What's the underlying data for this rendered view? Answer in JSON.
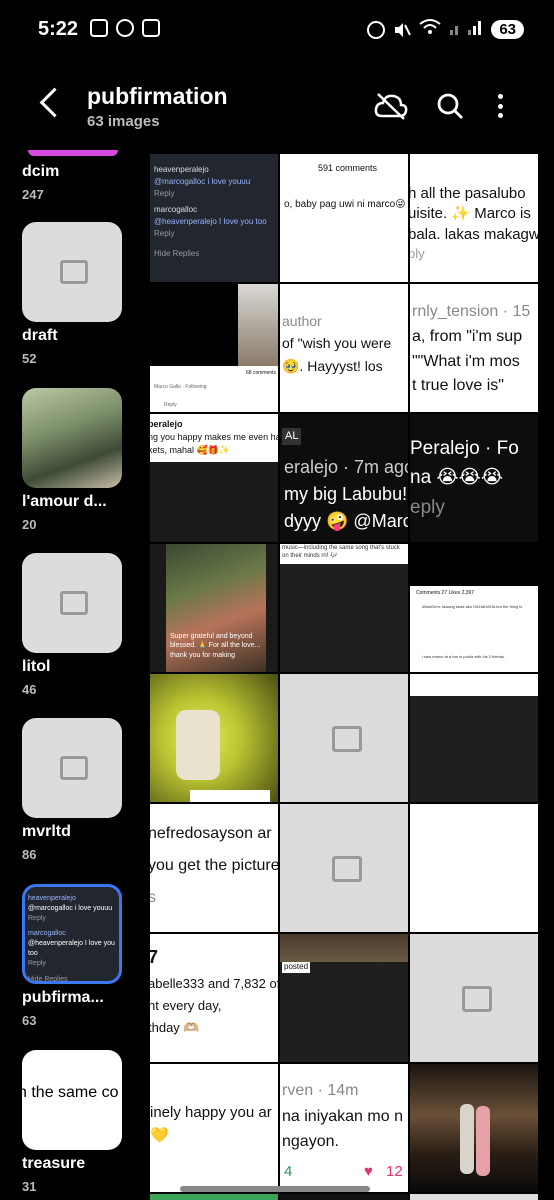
{
  "status": {
    "time": "5:22",
    "battery": "63"
  },
  "header": {
    "title": "pubfirmation",
    "subtitle": "63 images"
  },
  "albums": [
    {
      "name": "dcim",
      "count": "247"
    },
    {
      "name": "draft",
      "count": "52"
    },
    {
      "name": "l'amour d...",
      "count": "20"
    },
    {
      "name": "litol",
      "count": "46"
    },
    {
      "name": "mvrltd",
      "count": "86"
    },
    {
      "name": "pubfirma...",
      "count": "63"
    },
    {
      "name": "treasure",
      "count": "31"
    }
  ],
  "selected_album_preview": {
    "user1": "heavenperalejo",
    "time1": "14h · Author",
    "text1": "@marcogalloc i love youuu",
    "reply1": "Reply",
    "user2": "marcogalloc",
    "time2": "3h",
    "text2": "@heavenperalejo I love you too",
    "reply2": "Reply",
    "hide": "Hide Replies"
  },
  "treasure_preview": "h the same co",
  "grid": {
    "r1c1": {
      "user1": "heavenperalejo",
      "time1": "14h · Author",
      "text1": "@marcogalloc i love youuu",
      "reply1": "Reply",
      "user2": "marcogalloc",
      "time2": "3h",
      "text2": "@heavenperalejo I love you too",
      "reply2": "Reply",
      "hide": "Hide Replies"
    },
    "r1c2": {
      "comments": "591 comments",
      "text": "o, baby pag uwi ni marco😜"
    },
    "r1c3": {
      "line1": "h all the pasalubo",
      "line2": "uisite. ✨ Marco is",
      "line3": "bala. lakas makagw",
      "line4": "ply"
    },
    "r2c1": {
      "count": "68 comments",
      "name": "Marco Gallo · Following",
      "reply": "Reply"
    },
    "r2c2": {
      "line1": "author",
      "line2": "of \"wish you were",
      "line3": "🥹. Hayyyst! los"
    },
    "r2c3": {
      "line1": "rnly_tension · 15",
      "line2": "a, from \"i'm sup",
      "line3": "\"\"What i'm mos",
      "line4": "t true love is\""
    },
    "r3c1": {
      "line1": "peralejo",
      "line2": "ng you happy makes me even ha",
      "line3": "kets, mahal 🥰🎁✨"
    },
    "r3c2": {
      "tag": "AL",
      "line1": "eralejo · 7m ago",
      "line2": "my big Labubu! t",
      "line3": "dyyy 🤪 @Marco"
    },
    "r3c3": {
      "line1": "Peralejo · Fo",
      "line2": "na 😭😭😭",
      "line3": "eply"
    },
    "r4c1": {
      "caption": "Super grateful and beyond blessed. 🙏 For all the love... thank you for making"
    },
    "r4c2": {
      "text": "music—including the same song that's stuck on their minds rn! 🎶"
    },
    "r4c3": {
      "tabs": "Comments 27   Likes 2,397",
      "line1": "#MarGem: tawang tawa ako HAHAHAHA but the thing is",
      "line2": "i saw marco at a bar in pobla with his 2 friends."
    },
    "r5c1": {
      "text": ""
    },
    "r6c1": {
      "line1": "nefredosayson ar",
      "line2": "you get the picture",
      "line3": "s"
    },
    "r7c1": {
      "line1": "7",
      "line2": "abelle333 and 7,832 of",
      "line3": "nt every day,",
      "line4": "thday 🫶🏼"
    },
    "r7c2": {
      "text": "posted"
    },
    "r8c1": {
      "line1": "inely happy you ar",
      "line2": "💛"
    },
    "r8c2": {
      "line1": "rven · 14m",
      "line2": "na iniyakan mo n",
      "line3": "ngayon.",
      "count1": "4",
      "count2": "12"
    }
  },
  "colors": {
    "accent": "#3b78f0",
    "pink": "#d64ae0",
    "heart": "#e8336b"
  }
}
